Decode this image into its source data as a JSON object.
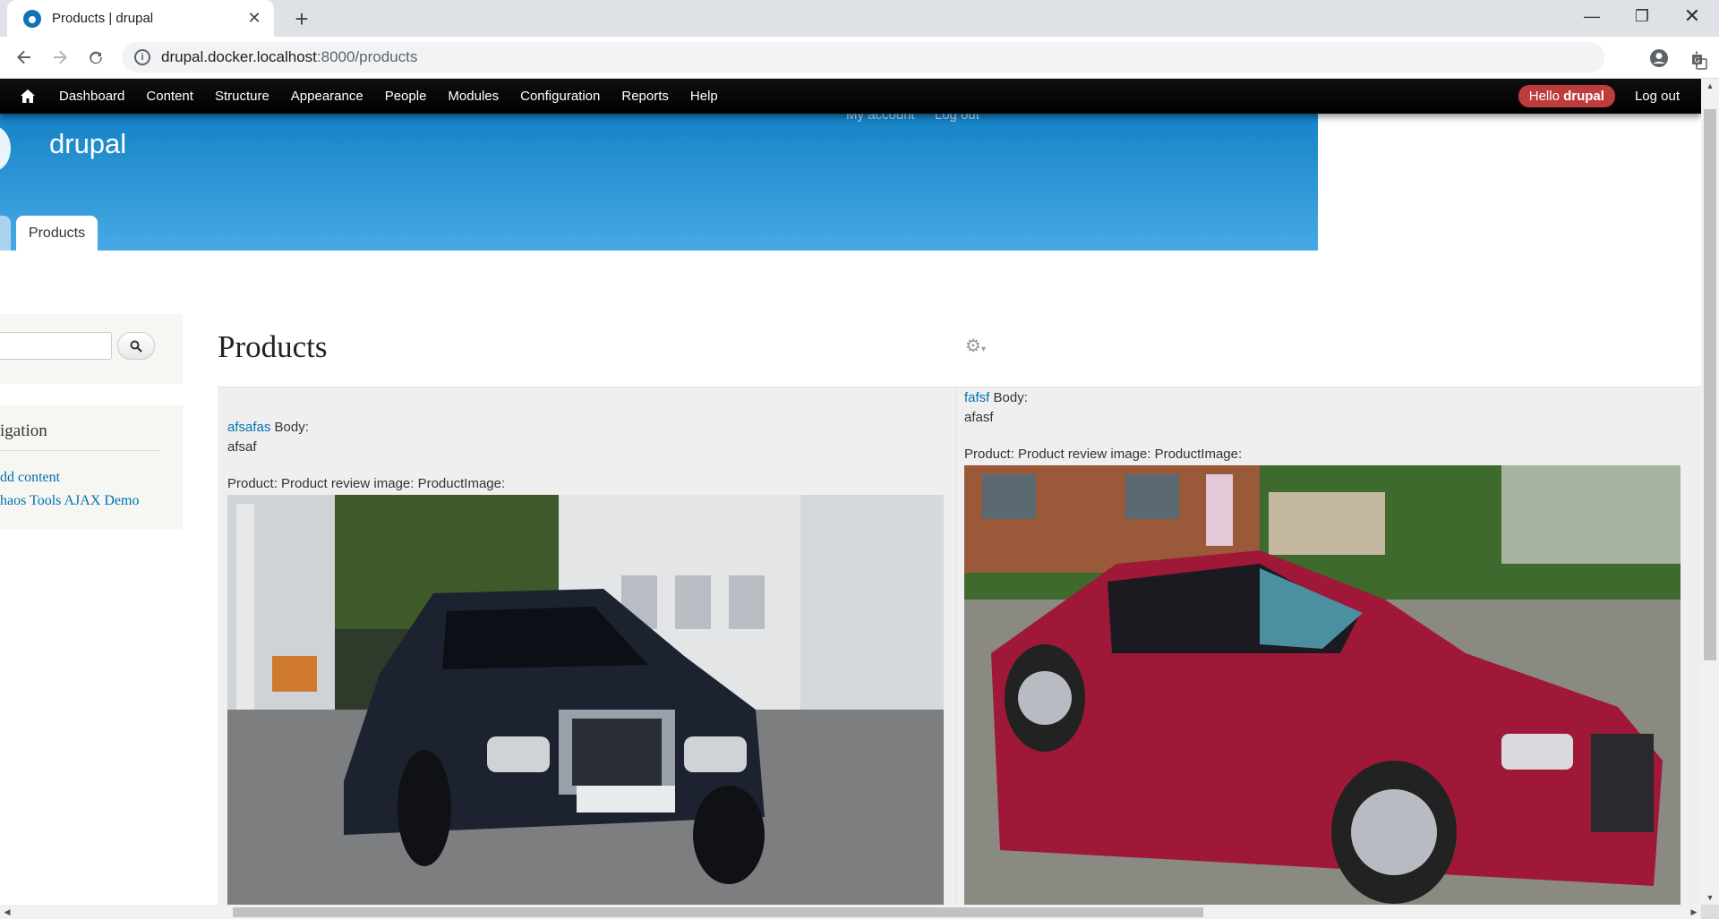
{
  "browser": {
    "tab_title": "Products | drupal",
    "tab_close": "✕",
    "new_tab": "+",
    "url_host": "drupal.docker.localhost",
    "url_path": ":8000/products",
    "controls": {
      "minimize": "—",
      "maximize": "❐",
      "close": "✕"
    }
  },
  "admin_toolbar": {
    "items": [
      "Dashboard",
      "Content",
      "Structure",
      "Appearance",
      "People",
      "Modules",
      "Configuration",
      "Reports",
      "Help"
    ],
    "hello_prefix": "Hello ",
    "hello_user": "drupal",
    "logout": "Log out"
  },
  "header": {
    "site_name": "drupal",
    "secondary_menu": [
      "My account",
      "Log out"
    ],
    "active_tab": "Products"
  },
  "sidebar": {
    "navigation_title": "igation",
    "links": [
      "dd content",
      "haos Tools AJAX Demo"
    ]
  },
  "main": {
    "page_title": "Products",
    "products": [
      {
        "title": "afsafas",
        "body_label": " Body:",
        "body": "afsaf",
        "image_label": "Product: Product review image: ProductImage:"
      },
      {
        "title": "fafsf",
        "body_label": " Body:",
        "body": "afasf",
        "image_label": "Product: Product review image: ProductImage:"
      }
    ]
  },
  "colors": {
    "header_top": "#0779bf",
    "header_bottom": "#48a9e4",
    "link": "#0071b3",
    "hello_pill": "#bf3c3c"
  }
}
